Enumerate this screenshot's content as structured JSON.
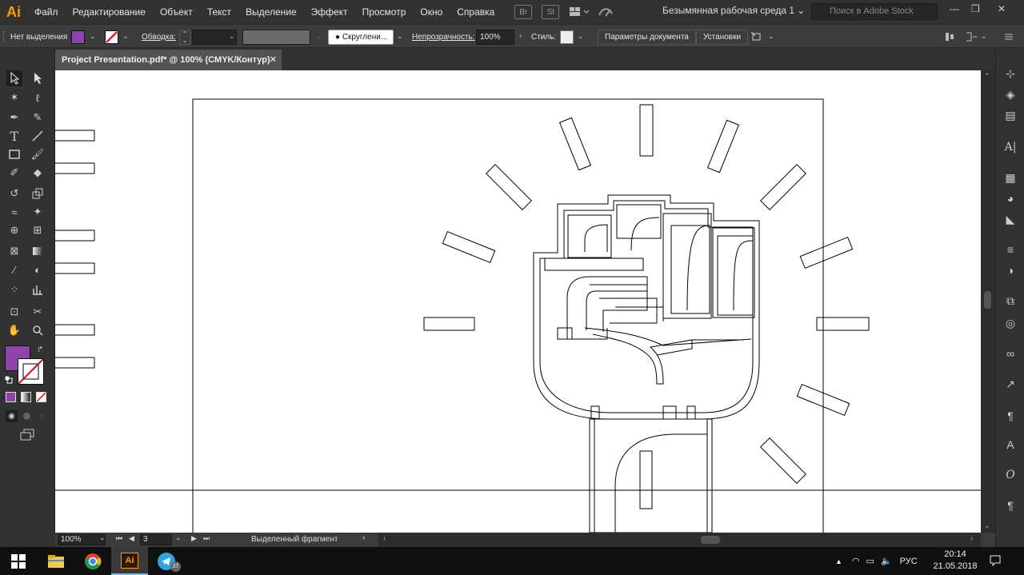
{
  "app": {
    "logo": "Ai"
  },
  "menu": [
    "Файл",
    "Редактирование",
    "Объект",
    "Текст",
    "Выделение",
    "Эффект",
    "Просмотр",
    "Окно",
    "Справка"
  ],
  "bridge_icons": [
    "Br",
    "St"
  ],
  "workspace": "Безымянная рабочая среда 1",
  "search": {
    "placeholder": "Поиск в Adobe Stock"
  },
  "control": {
    "selection": "Нет выделения",
    "fill_color": "#8e44ad",
    "stroke_label": "Обводка:",
    "brush": "Скруглени...",
    "opacity_label": "Непрозрачность:",
    "opacity_value": "100%",
    "style_label": "Стиль:",
    "doc_setup": "Параметры документа",
    "prefs": "Установки"
  },
  "document": {
    "tab_title": "Project Presentation.pdf* @ 100% (CMYK/Контур)",
    "close": "✕"
  },
  "status": {
    "zoom": "100%",
    "page": "3",
    "info": "Выделенный фрагмент"
  },
  "taskbar": {
    "lang": "РУС",
    "time": "20:14",
    "date": "21.05.2018",
    "telegram_badge": "27"
  },
  "colors": {
    "accent": "#8e44ad",
    "ui_bg": "#323232",
    "ai_orange": "#ff9a00"
  }
}
